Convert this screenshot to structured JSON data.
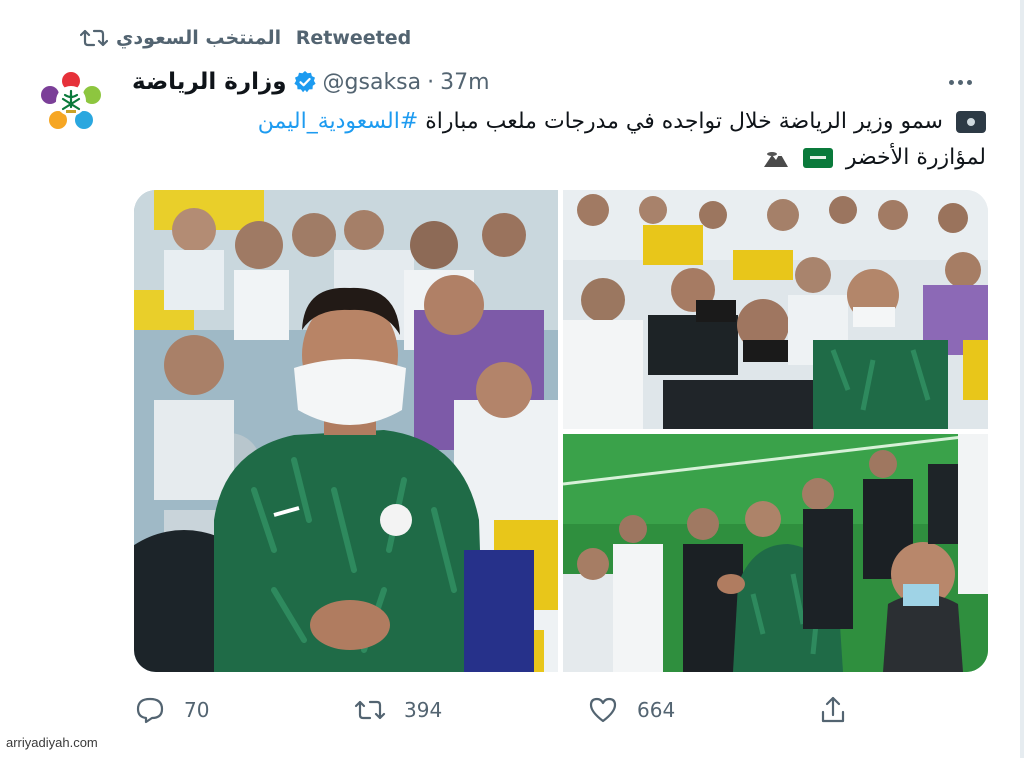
{
  "retweet": {
    "label": "Retweeted",
    "retweeter_name": "المنتخب السعودي"
  },
  "author": {
    "display_name": "وزارة الرياضة",
    "handle": "@gsaksa",
    "separator": "·",
    "time": "37m",
    "verified": true,
    "avatar_icon": "ministry-logo-icon"
  },
  "tweet": {
    "line1_text": "سمو وزير الرياضة خلال تواجده في مدرجات ملعب مباراة",
    "hashtag": "#السعودية_اليمن",
    "line2_text": "لمؤازرة الأخضر",
    "emoji_camera": "camera-icon",
    "emoji_flag": "saudi-flag-icon",
    "emoji_eagle": "eagle-icon"
  },
  "media": {
    "count": 3,
    "photos": [
      "stadium-fan-photo",
      "stands-crowd-photo",
      "standing-fans-photo"
    ]
  },
  "actions": {
    "reply_count": "70",
    "retweet_count": "394",
    "like_count": "664"
  },
  "watermark": "arriyadiyah.com",
  "colors": {
    "accent": "#1d9bf0",
    "muted": "#536471",
    "text": "#0f1419",
    "jersey_green": "#1f6b47",
    "seat_yellow": "#e8c61a"
  }
}
